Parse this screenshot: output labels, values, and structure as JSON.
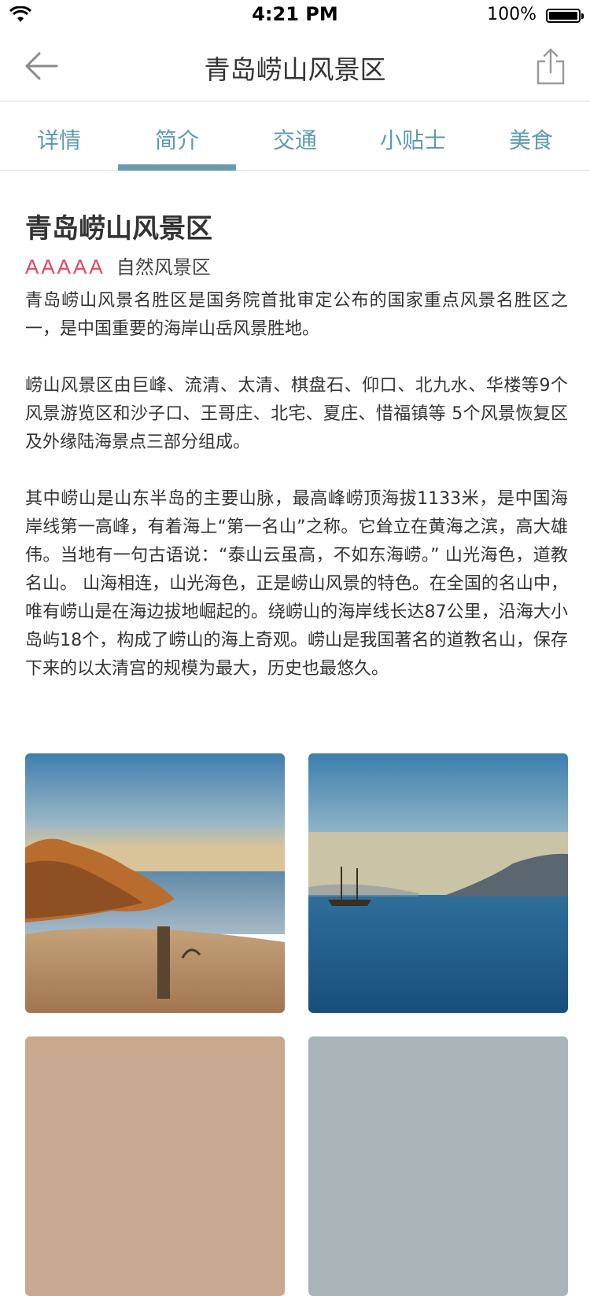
{
  "status_bar": {
    "time": "4:21 PM",
    "battery": "100%"
  },
  "nav": {
    "title": "青岛崂山风景区",
    "back_icon": "back-arrow-icon",
    "share_icon": "share-icon"
  },
  "tabs": [
    {
      "label": "详情",
      "active": false
    },
    {
      "label": "简介",
      "active": true
    },
    {
      "label": "交通",
      "active": false
    },
    {
      "label": "小贴士",
      "active": false
    },
    {
      "label": "美食",
      "active": false
    }
  ],
  "content": {
    "title": "青岛崂山风景区",
    "rating": "AAAAA",
    "category": "自然风景区",
    "paragraphs": [
      "青岛崂山风景名胜区是国务院首批审定公布的国家重点风景名胜区之一，是中国重要的海岸山岳风景胜地。",
      "崂山风景区由巨峰、流清、太清、棋盘石、仰口、北九水、华楼等9个风景游览区和沙子口、王哥庄、北宅、夏庄、惜福镇等 5个风景恢复区及外缘陆海景点三部分组成。",
      "其中崂山是山东半岛的主要山脉，最高峰崂顶海拔1133米，是中国海岸线第一高峰，有着海上“第一名山”之称。它耸立在黄海之滨，高大雄伟。当地有一句古语说：“泰山云虽高，不如东海崂。” 山光海色，道教名山。 山海相连，山光海色，正是崂山风景的特色。在全国的名山中，唯有崂山是在海边拔地崛起的。绕崂山的海岸线长达87公里，沿海大小岛屿18个，构成了崂山的海上奇观。崂山是我国著名的道教名山，保存下来的以太清宫的规模为最大，历史也最悠久。"
    ]
  },
  "colors": {
    "accent": "#6a9aad",
    "tab_text": "#5f9ab0",
    "rating": "#e1465f"
  }
}
